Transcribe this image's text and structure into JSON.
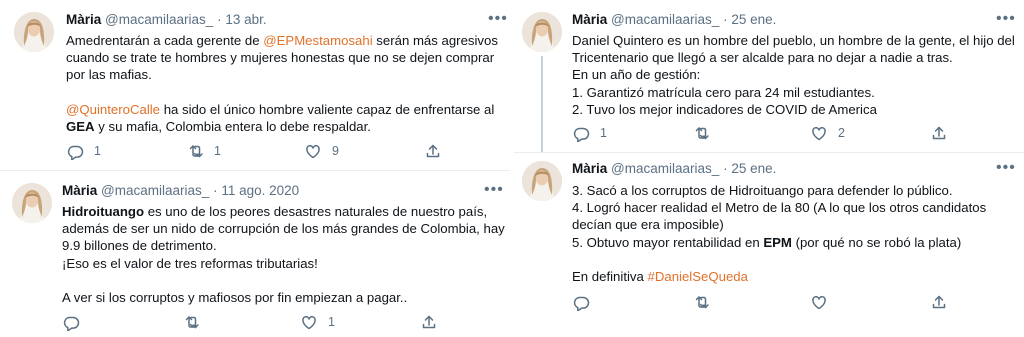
{
  "tweets": [
    {
      "name": "Mària",
      "handle": "@macamilaarias_",
      "sep": "·",
      "date": "13 abr.",
      "lines": [
        {
          "parts": [
            {
              "t": "Amedrentarán a cada gerente de "
            },
            {
              "t": "@EPMestamosahi",
              "s": "mention"
            },
            {
              "t": " serán más agresivos"
            }
          ]
        },
        {
          "parts": [
            {
              "t": "cuando se trate te hombres y mujeres honestas que no se dejen comprar"
            }
          ]
        },
        {
          "parts": [
            {
              "t": "por las mafias."
            }
          ]
        },
        {
          "parts": []
        },
        {
          "parts": [
            {
              "t": "@QuinteroCalle",
              "s": "mention"
            },
            {
              "t": " ha sido el único hombre valiente capaz de enfrentarse al"
            }
          ]
        },
        {
          "parts": [
            {
              "t": "GEA",
              "s": "bold"
            },
            {
              "t": " y su mafia, Colombia entera lo debe respaldar."
            }
          ]
        }
      ],
      "reply_count": "1",
      "retweet_count": "1",
      "like_count": "9"
    },
    {
      "name": "Mària",
      "handle": "@macamilaarias_",
      "sep": "·",
      "date": "11 ago. 2020",
      "lines": [
        {
          "parts": [
            {
              "t": "Hidroituango",
              "s": "bold"
            },
            {
              "t": " es uno de los peores desastres naturales de nuestro país,"
            }
          ]
        },
        {
          "parts": [
            {
              "t": "además de ser un nido de corrupción de los más grandes de Colombia, hay"
            }
          ]
        },
        {
          "parts": [
            {
              "t": "9.9 billones de detrimento."
            }
          ]
        },
        {
          "parts": [
            {
              "t": "¡Eso es el valor de tres reformas tributarias!"
            }
          ]
        },
        {
          "parts": []
        },
        {
          "parts": [
            {
              "t": "A ver si los corruptos y mafiosos por fin empiezan a pagar.."
            }
          ]
        }
      ],
      "reply_count": "",
      "retweet_count": "",
      "like_count": "1"
    },
    {
      "name": "Mària",
      "handle": "@macamilaarias_",
      "sep": "·",
      "date": "25 ene.",
      "lines": [
        {
          "parts": [
            {
              "t": "Daniel Quintero es un hombre del pueblo, un hombre de la gente, el hijo del"
            }
          ]
        },
        {
          "parts": [
            {
              "t": "Tricentenario que llegó a ser alcalde para no dejar a nadie a tras."
            }
          ]
        },
        {
          "parts": [
            {
              "t": "En un año de gestión:"
            }
          ]
        },
        {
          "parts": [
            {
              "t": "1. Garantizó matrícula cero para 24 mil estudiantes."
            }
          ]
        },
        {
          "parts": [
            {
              "t": "2. Tuvo los mejor indicadores de COVID de America"
            }
          ]
        }
      ],
      "reply_count": "1",
      "retweet_count": "",
      "like_count": "2"
    },
    {
      "name": "Mària",
      "handle": "@macamilaarias_",
      "sep": "·",
      "date": "25 ene.",
      "lines": [
        {
          "parts": [
            {
              "t": "3. Sacó a los corruptos de Hidroituango para defender lo público."
            }
          ]
        },
        {
          "parts": [
            {
              "t": "4. Logró hacer realidad el Metro de la 80 (A lo que los otros candidatos"
            }
          ]
        },
        {
          "parts": [
            {
              "t": "decían que era imposible)"
            }
          ]
        },
        {
          "parts": [
            {
              "t": "5. Obtuvo mayor rentabilidad en "
            },
            {
              "t": "EPM",
              "s": "bold"
            },
            {
              "t": " (por qué no se robó la plata)"
            }
          ]
        },
        {
          "parts": []
        },
        {
          "parts": [
            {
              "t": "En definitiva "
            },
            {
              "t": "#DanielSeQueda",
              "s": "mention"
            }
          ]
        }
      ],
      "reply_count": "",
      "retweet_count": "",
      "like_count": ""
    }
  ],
  "icons": {
    "reply": "reply-icon",
    "retweet": "retweet-icon",
    "like": "heart-icon",
    "share": "share-icon",
    "more": "more-icon"
  },
  "colors": {
    "mention": "#e0722b",
    "muted": "#5b7083",
    "text": "#0f1419"
  }
}
